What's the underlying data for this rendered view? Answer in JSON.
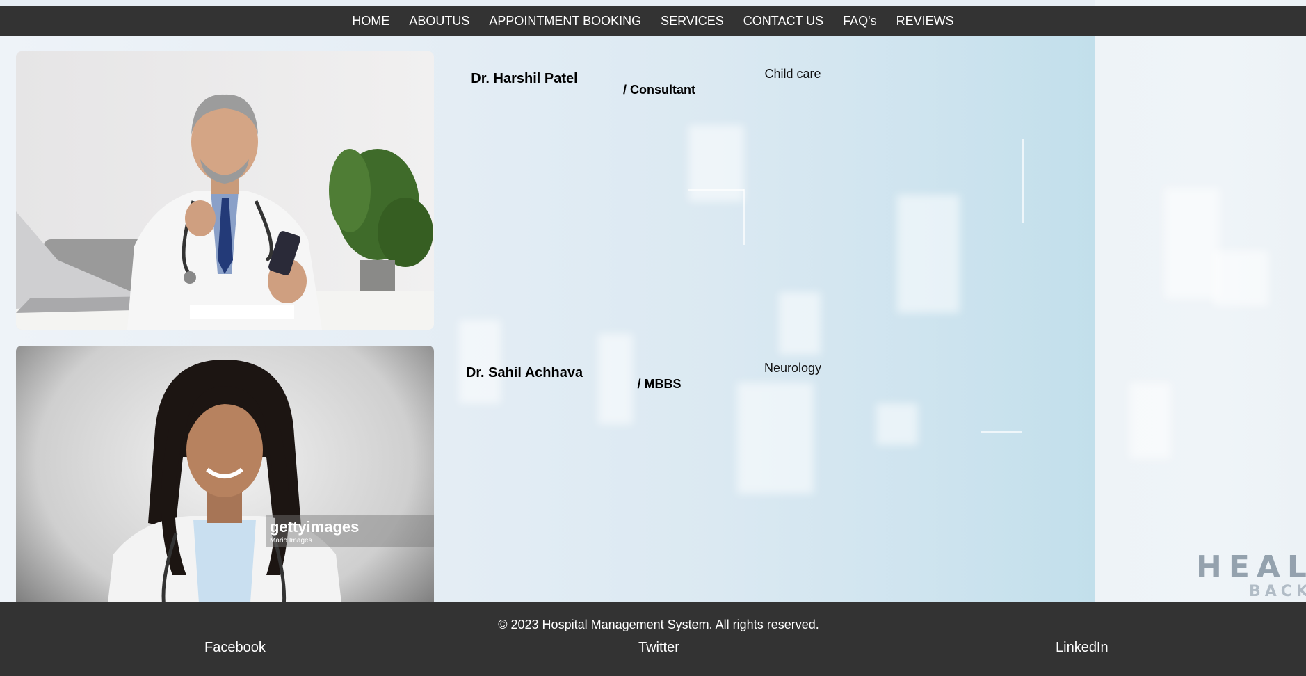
{
  "nav": {
    "items": [
      {
        "label": "HOME"
      },
      {
        "label": "ABOUTUS"
      },
      {
        "label": "APPOINTMENT BOOKING"
      },
      {
        "label": "SERVICES"
      },
      {
        "label": "CONTACT US"
      },
      {
        "label": "FAQ's"
      },
      {
        "label": "REVIEWS"
      }
    ]
  },
  "doctors": [
    {
      "name": "Dr. Harshil Patel",
      "role": "/ Consultant",
      "specialty": "Child care"
    },
    {
      "name": "Dr. Sahil Achhava",
      "role": "/ MBBS",
      "specialty": "Neurology"
    }
  ],
  "background": {
    "watermark_main": "HEALT",
    "watermark_sub": "BACK"
  },
  "photo_watermark": {
    "brand": "gettyimages",
    "credit": "Mario Images"
  },
  "footer": {
    "copyright": "© 2023 Hospital Management System. All rights reserved.",
    "social": [
      "Facebook",
      "Twitter",
      "LinkedIn"
    ]
  },
  "colors": {
    "nav_bg": "#333333",
    "footer_bg": "#333333",
    "text_light": "#ffffff"
  }
}
